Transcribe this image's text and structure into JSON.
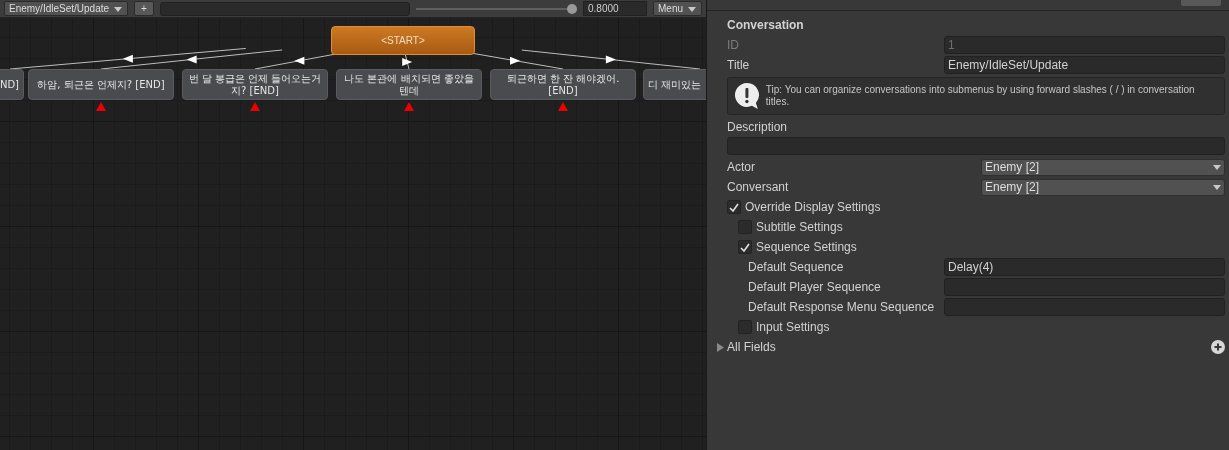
{
  "toolbar": {
    "conversation": "Enemy/IdleSet/Update",
    "add_button": "+",
    "zoom_slider": {
      "level": 0.97
    },
    "zoom": "0.8000",
    "menu": "Menu"
  },
  "graph": {
    "start": "<START>",
    "nodes": [
      {
        "text": "ND]"
      },
      {
        "text": "하암, 퇴근은 언제지? [END]"
      },
      {
        "text": "번 달 봉급은 언제 들어오는거지? [END]"
      },
      {
        "text": "나도 본관에 배치되면 좋았을 텐데"
      },
      {
        "text": "퇴근하면 한 잔 해야겠어. [END]"
      },
      {
        "text": "디 재미있는"
      }
    ]
  },
  "inspector": {
    "heading": "Conversation",
    "rows": [
      {
        "kind": "text",
        "label": "ID",
        "value": "1",
        "disabled": true
      },
      {
        "kind": "text",
        "label": "Title",
        "value": "Enemy/IdleSet/Update",
        "disabled": false
      },
      {
        "kind": "tip",
        "text": "Tip: You can organize conversations into submenus by using forward slashes ( / ) in conversation titles."
      },
      {
        "kind": "area",
        "label": "Description"
      },
      {
        "kind": "dropdown",
        "label": "Actor",
        "value": "Enemy [2]"
      },
      {
        "kind": "dropdown",
        "label": "Conversant",
        "value": "Enemy [2]"
      },
      {
        "kind": "checkbox",
        "label": "Override Display Settings",
        "checked": true,
        "children": [
          {
            "kind": "checkbox",
            "label": "Subtitle Settings",
            "checked": false
          },
          {
            "kind": "checkbox",
            "label": "Sequence Settings",
            "checked": true,
            "children": [
              {
                "kind": "text",
                "label": "Default Sequence",
                "value": "Delay(4)",
                "disabled": false
              },
              {
                "kind": "text",
                "label": "Default Player Sequence",
                "disabled": false
              },
              {
                "kind": "text",
                "label": "Default Response Menu Sequence",
                "disabled": false
              }
            ]
          },
          {
            "kind": "checkbox",
            "label": "Input Settings",
            "checked": false
          }
        ]
      },
      {
        "kind": "foldout",
        "label": "All Fields",
        "expanded": false
      }
    ]
  }
}
